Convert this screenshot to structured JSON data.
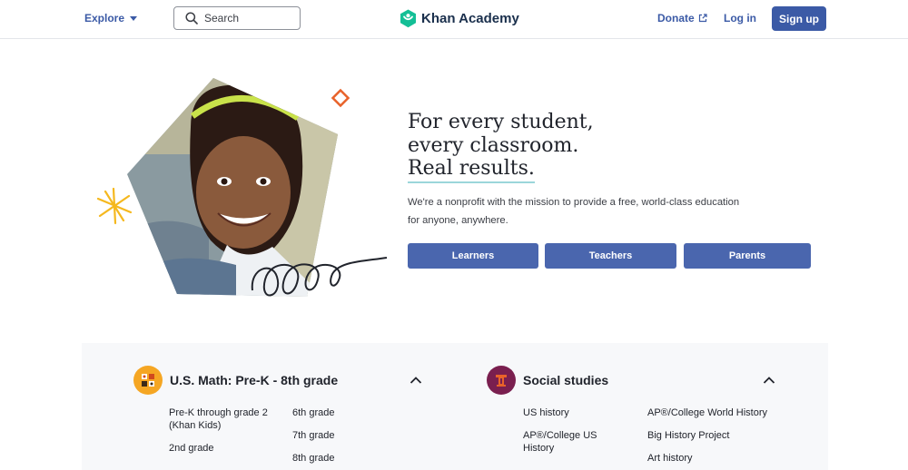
{
  "header": {
    "explore_label": "Explore",
    "search_label": "Search",
    "brand": "Khan Academy",
    "donate_label": "Donate",
    "login_label": "Log in",
    "signup_label": "Sign up"
  },
  "hero": {
    "headline_line1": "For every student,",
    "headline_line2": "every classroom.",
    "headline_line3": "Real results.",
    "description_line1": "We're a nonprofit with the mission to provide a free, world-class education",
    "description_line2": "for anyone, anywhere.",
    "buttons": {
      "learners": "Learners",
      "teachers": "Teachers",
      "parents": "Parents"
    }
  },
  "courses": {
    "math": {
      "title": "U.S. Math: Pre-K - 8th grade",
      "col1": [
        "Pre-K through grade 2",
        "(Khan Kids)",
        "2nd grade"
      ],
      "col2": [
        "6th grade",
        "7th grade",
        "8th grade"
      ]
    },
    "social": {
      "title": "Social studies",
      "col1": [
        "US history",
        "AP®/College US",
        "History"
      ],
      "col2": [
        "AP®/College World History",
        "Big History Project",
        "Art history"
      ]
    }
  },
  "colors": {
    "brand_blue": "#3b5aa6",
    "button_blue": "#4a66ae",
    "logo_green": "#14bf96",
    "math_icon_bg": "#f5a623",
    "social_icon_bg": "#7a1f4f"
  }
}
